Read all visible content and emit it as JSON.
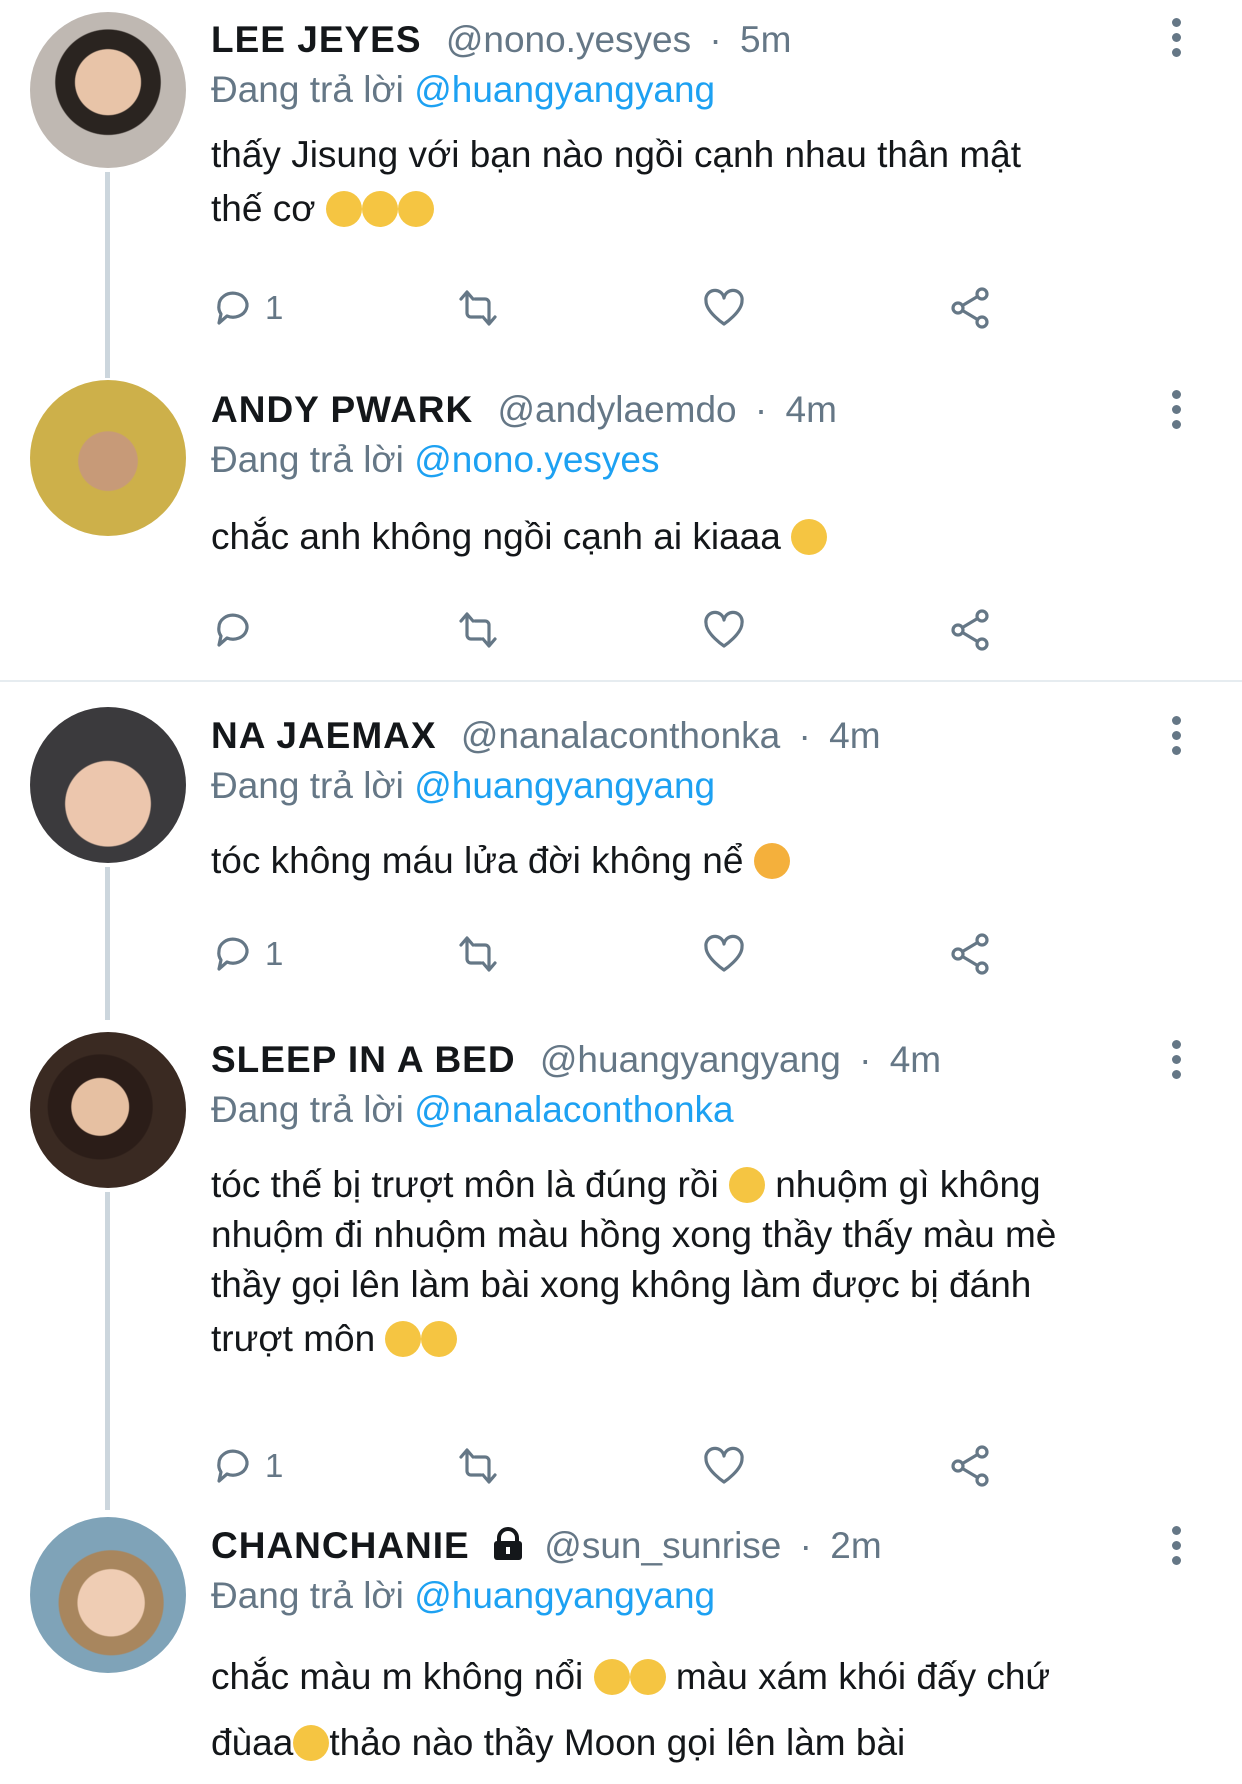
{
  "tweets": [
    {
      "name": "LEE JEYES",
      "handle": "@nono.yesyes",
      "sep": "·",
      "time": "5m",
      "reply_prefix": "Đang trả lời",
      "reply_to": "@huangyangyang",
      "text_line1": "thấy Jisung với bạn nào ngồi cạnh nhau thân mật",
      "text_line2": "thế cơ",
      "reply_count": "1"
    },
    {
      "name": "ANDY PWARK",
      "handle": "@andylaemdo",
      "sep": "·",
      "time": "4m",
      "reply_prefix": "Đang trả lời",
      "reply_to": "@nono.yesyes",
      "text_line1": "chắc anh không ngồi cạnh ai kiaaa",
      "reply_count": ""
    },
    {
      "name": "NA JAEMAX",
      "handle": "@nanalaconthonka",
      "sep": "·",
      "time": "4m",
      "reply_prefix": "Đang trả lời",
      "reply_to": "@huangyangyang",
      "text_line1": "tóc không máu lửa đời không nể",
      "reply_count": "1"
    },
    {
      "name": "SLEEP IN A BED",
      "handle": "@huangyangyang",
      "sep": "·",
      "time": "4m",
      "reply_prefix": "Đang trả lời",
      "reply_to": "@nanalaconthonka",
      "text_line1a": "tóc thế bị trượt môn là đúng rồi",
      "text_line1b": "nhuộm gì không",
      "text_line2": "nhuộm đi nhuộm màu hồng xong thầy thấy màu mè",
      "text_line3": "thầy gọi lên làm bài xong không làm được bị đánh",
      "text_line4": "trượt môn",
      "reply_count": "1"
    },
    {
      "name": "CHANCHANIE",
      "handle": "@sun_sunrise",
      "sep": "·",
      "time": "2m",
      "reply_prefix": "Đang trả lời",
      "reply_to": "@huangyangyang",
      "text_line1a": "chắc màu m không nổi",
      "text_line1b": "màu xám khói đấy chứ",
      "text_line2a": "đùaa",
      "text_line2b": "thảo nào thầy Moon gọi lên làm bài"
    }
  ],
  "colors": {
    "link": "#1da1f2",
    "secondary_text": "#657786",
    "thread_line": "#ccd6dd",
    "divider": "#e6ecf0"
  },
  "icons": [
    "reply-icon",
    "retweet-icon",
    "like-icon",
    "share-icon",
    "more-icon",
    "lock-icon"
  ]
}
